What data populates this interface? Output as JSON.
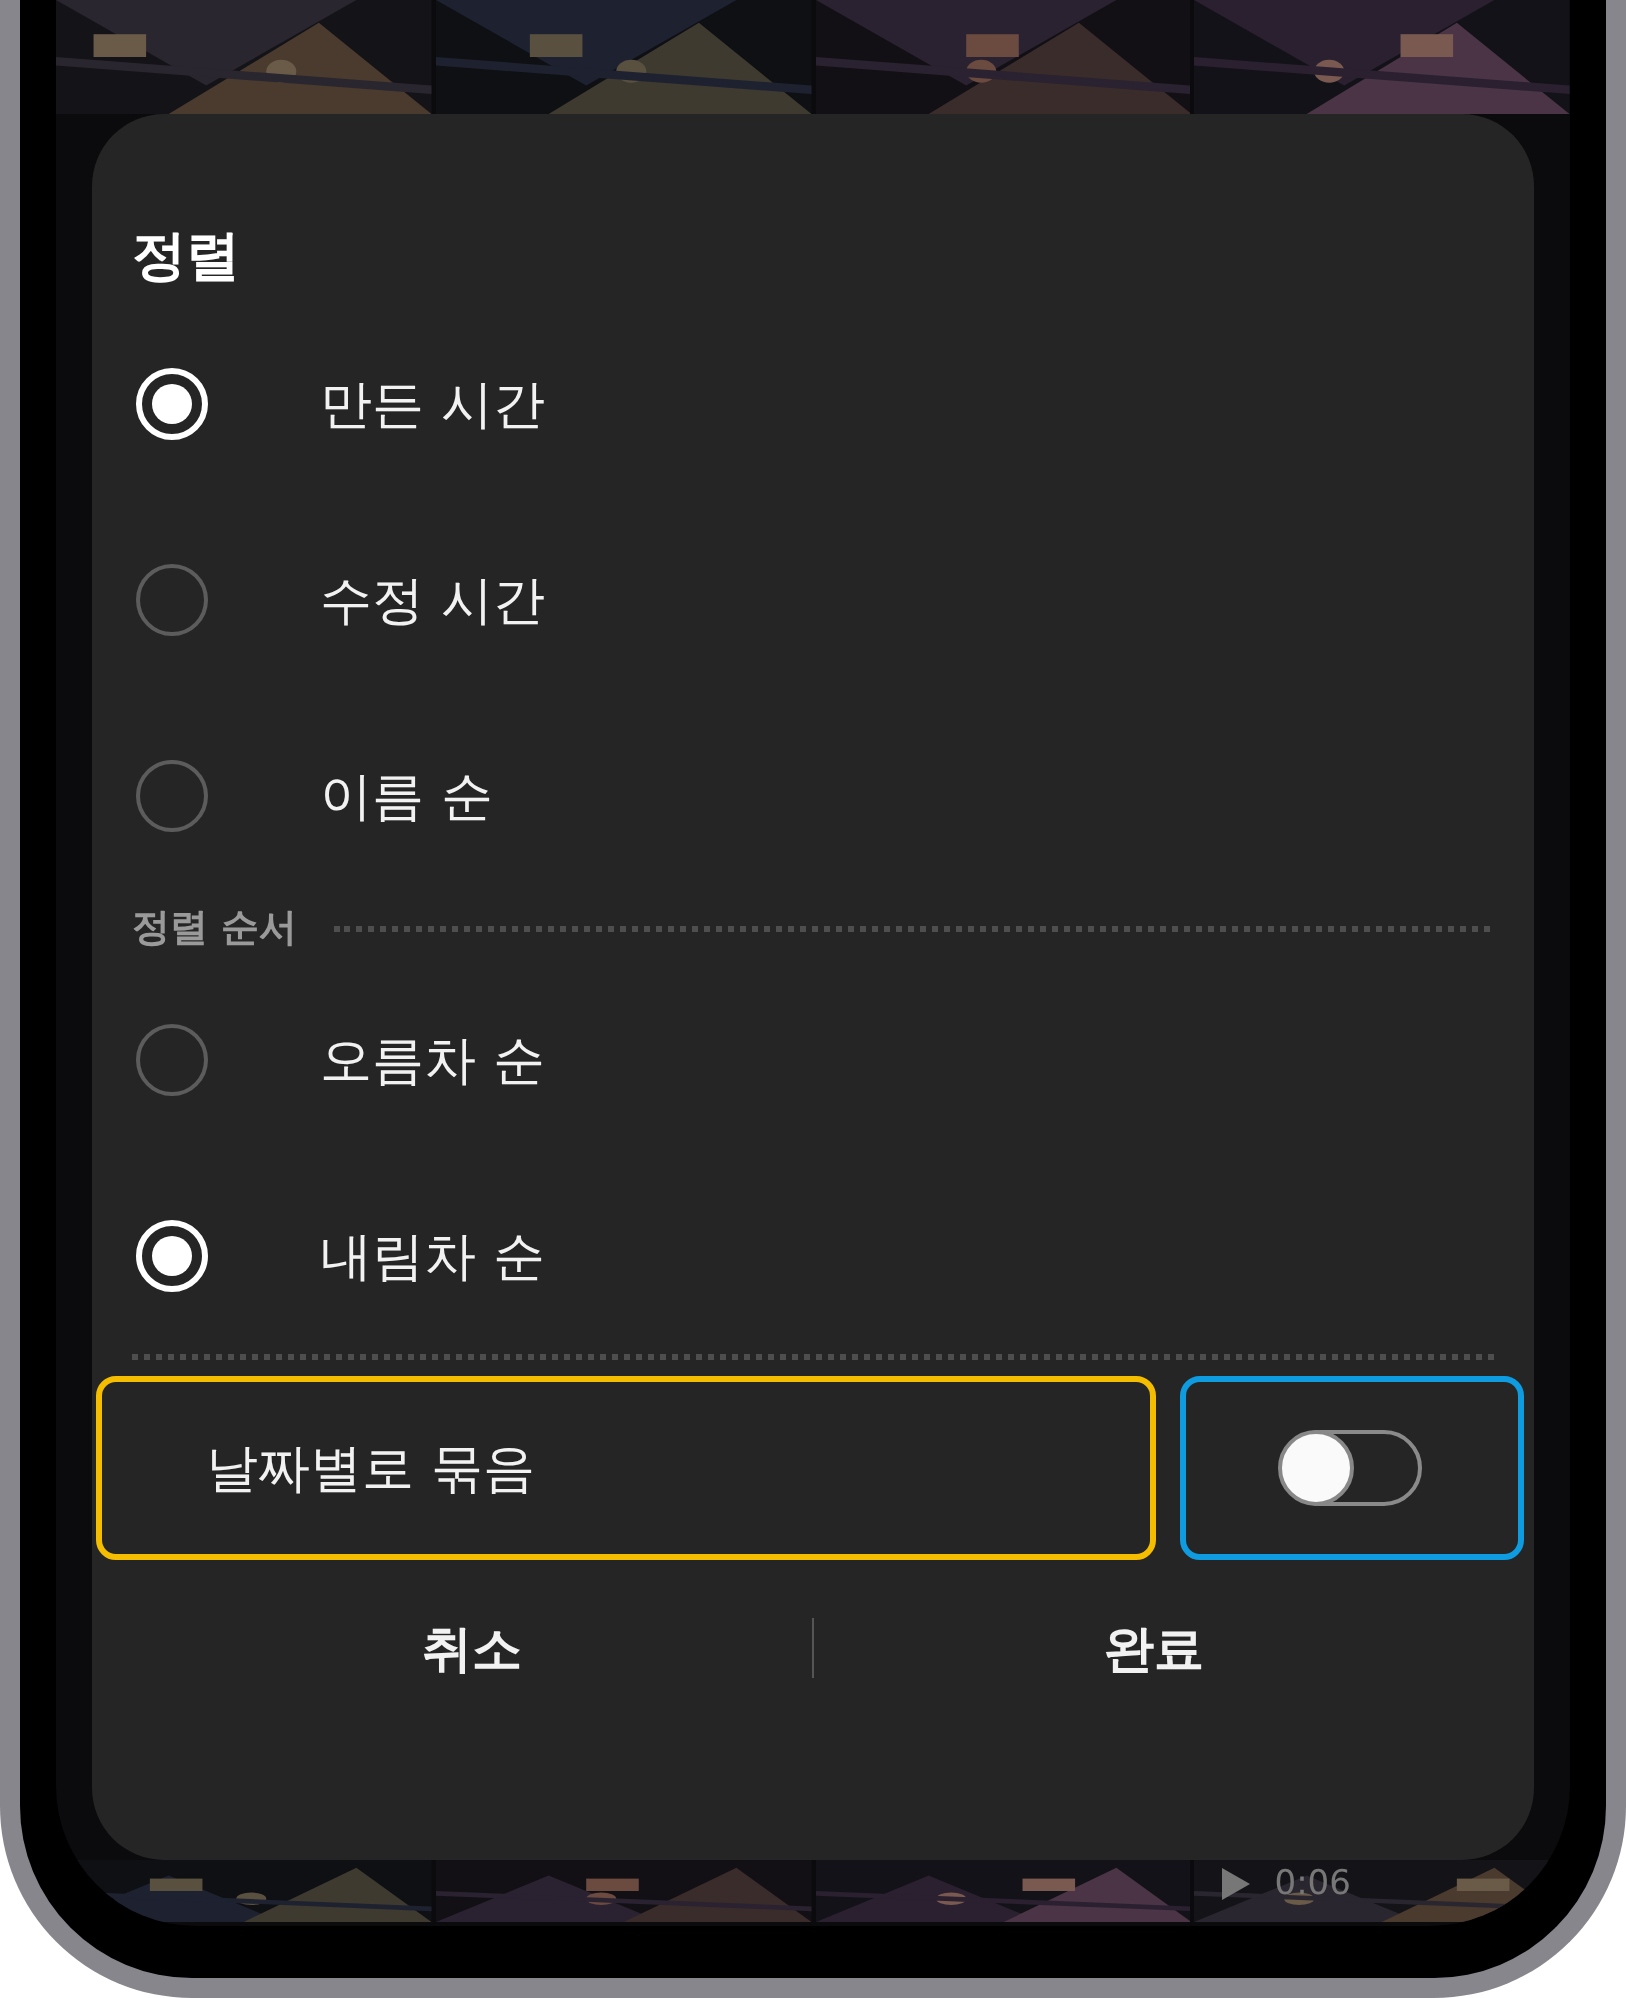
{
  "title": "정렬",
  "sort_options": [
    {
      "label": "만든 시간",
      "selected": true
    },
    {
      "label": "수정 시간",
      "selected": false
    },
    {
      "label": "이름 순",
      "selected": false
    }
  ],
  "order_header": "정렬 순서",
  "order_options": [
    {
      "label": "오름차 순",
      "selected": false
    },
    {
      "label": "내림차 순",
      "selected": true
    }
  ],
  "group_by_date": {
    "label": "날짜별로 묶음",
    "on": false
  },
  "buttons": [
    {
      "label": "취소"
    },
    {
      "label": "완료"
    }
  ],
  "video_duration": "0:06"
}
